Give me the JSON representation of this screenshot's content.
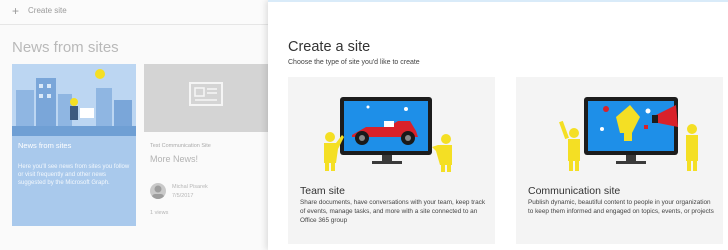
{
  "command_bar": {
    "plus_glyph": "+",
    "create_site_label": "Create site"
  },
  "news": {
    "heading": "News from sites",
    "card1": {
      "title": "News from sites",
      "description": "Here you'll see news from sites you follow or visit frequently and other news suggested by the Microsoft Graph."
    },
    "card2": {
      "site": "Test Communication Site",
      "title": "More News!",
      "author": "Michal Pisarek",
      "date": "7/5/2017",
      "views": "1 views"
    }
  },
  "panel": {
    "title": "Create a site",
    "subtitle": "Choose the type of site you'd like to create",
    "team": {
      "title": "Team site",
      "description": "Share documents, have conversations with your team, keep track of events, manage tasks, and more with a site connected to an Office 365 group"
    },
    "communication": {
      "title": "Communication site",
      "description": "Publish dynamic, beautiful content to people in your organization to keep them informed and engaged on topics, events, or projects"
    }
  },
  "colors": {
    "accent": "#0078d4",
    "illustration_blue": "#1e8fe8",
    "figure_yellow": "#f4df24"
  },
  "icons": [
    "plus-icon",
    "news-article-icon",
    "team-site-illustration",
    "communication-site-illustration"
  ]
}
